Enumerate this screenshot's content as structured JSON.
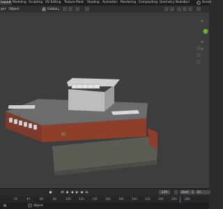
{
  "workspace_tabs": [
    "Layout",
    "Modeling",
    "Sculpting",
    "UV Editing",
    "Texture Paint",
    "Shading",
    "Animation",
    "Rendering",
    "Compositing",
    "Geometry Nodes",
    "Scri"
  ],
  "active_tab": "Layout",
  "header": {
    "mode_label": "Object",
    "menu_left": "ger",
    "transform_orientation": "Global",
    "scene_label": "Scene"
  },
  "playback": {
    "current_frame": "239",
    "start_label": "Start",
    "start_value": "1",
    "end_label": "En"
  },
  "ruler_ticks": [
    "20",
    "40",
    "60",
    "80",
    "100",
    "120",
    "140",
    "160",
    "180",
    "200",
    "220",
    "240",
    "260",
    "280"
  ],
  "status": {
    "object_label": "Object"
  },
  "colors": {
    "accent": "#4772b3",
    "brick": "#8e3f2c",
    "roof": "#6c6c6c",
    "gizmo_green": "#6ab02e"
  }
}
